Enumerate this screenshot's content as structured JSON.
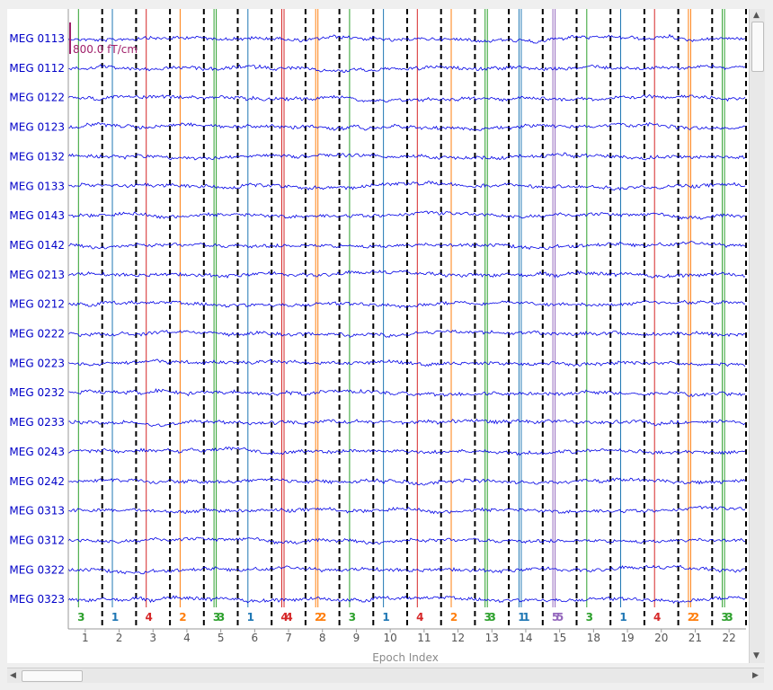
{
  "window": {
    "title": ""
  },
  "scale_bar": {
    "label": "800.0 fT/cm",
    "color": "#a0206a"
  },
  "axis": {
    "xlabel": "Epoch Index"
  },
  "colors": {
    "trace": "#0000e6",
    "boundary": "#000000",
    "event_1": "#1f77b4",
    "event_2": "#ff7f0e",
    "event_3": "#2ca02c",
    "event_4": "#d62728",
    "event_5": "#9467bd"
  },
  "chart_data": {
    "type": "line",
    "title": "",
    "xlabel": "Epoch Index",
    "ylabel": "",
    "channels": [
      "MEG 0113",
      "MEG 0112",
      "MEG 0122",
      "MEG 0123",
      "MEG 0132",
      "MEG 0133",
      "MEG 0143",
      "MEG 0142",
      "MEG 0213",
      "MEG 0212",
      "MEG 0222",
      "MEG 0223",
      "MEG 0232",
      "MEG 0233",
      "MEG 0243",
      "MEG 0242",
      "MEG 0313",
      "MEG 0312",
      "MEG 0322",
      "MEG 0323"
    ],
    "epoch_labels": [
      "1",
      "2",
      "3",
      "4",
      "5",
      "6",
      "7",
      "8",
      "9",
      "10",
      "11",
      "12",
      "13",
      "14",
      "15",
      "18",
      "19",
      "20",
      "21",
      "22"
    ],
    "events": [
      {
        "epoch": 1,
        "ids": [
          "3"
        ]
      },
      {
        "epoch": 2,
        "ids": [
          "1"
        ]
      },
      {
        "epoch": 3,
        "ids": [
          "4"
        ]
      },
      {
        "epoch": 4,
        "ids": [
          "2"
        ]
      },
      {
        "epoch": 5,
        "ids": [
          "3",
          "3"
        ]
      },
      {
        "epoch": 6,
        "ids": [
          "1"
        ]
      },
      {
        "epoch": 7,
        "ids": [
          "4",
          "4"
        ]
      },
      {
        "epoch": 8,
        "ids": [
          "2",
          "2"
        ]
      },
      {
        "epoch": 9,
        "ids": [
          "3"
        ]
      },
      {
        "epoch": 10,
        "ids": [
          "1"
        ]
      },
      {
        "epoch": 11,
        "ids": [
          "4"
        ]
      },
      {
        "epoch": 12,
        "ids": [
          "2"
        ]
      },
      {
        "epoch": 13,
        "ids": [
          "3",
          "3"
        ]
      },
      {
        "epoch": 14,
        "ids": [
          "1",
          "1"
        ]
      },
      {
        "epoch": 15,
        "ids": [
          "5",
          "5"
        ]
      },
      {
        "epoch": 18,
        "ids": [
          "3"
        ]
      },
      {
        "epoch": 19,
        "ids": [
          "1"
        ]
      },
      {
        "epoch": 20,
        "ids": [
          "4"
        ]
      },
      {
        "epoch": 21,
        "ids": [
          "2",
          "2"
        ]
      },
      {
        "epoch": 22,
        "ids": [
          "3",
          "3"
        ]
      }
    ],
    "grid": false,
    "legend": "none"
  }
}
